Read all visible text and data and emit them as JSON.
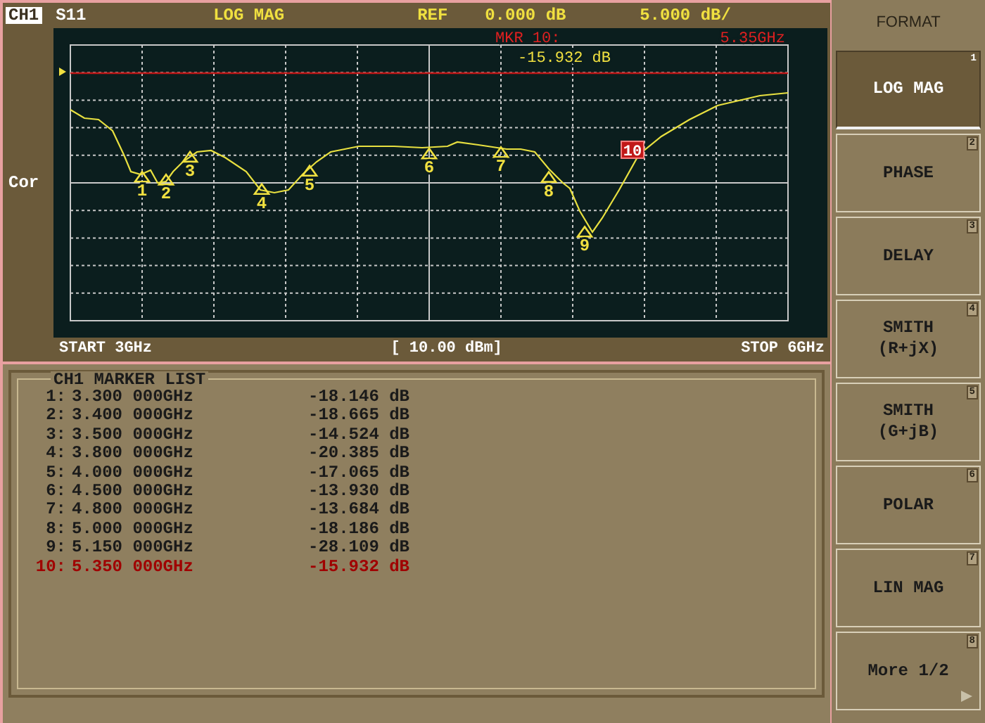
{
  "header": {
    "channel": "CH1",
    "parameter": "S11",
    "format": "LOG MAG",
    "ref_label": "REF",
    "ref_value": "0.000 dB",
    "scale": "5.000 dB/"
  },
  "plot": {
    "side_label": "Cor",
    "marker_readout": {
      "label": "MKR 10:",
      "frequency": "5.35GHz",
      "value": "-15.932 dB"
    },
    "markers": [
      {
        "label": "1",
        "active": false
      },
      {
        "label": "2",
        "active": false
      },
      {
        "label": "3",
        "active": false
      },
      {
        "label": "4",
        "active": false
      },
      {
        "label": "5",
        "active": false
      },
      {
        "label": "6",
        "active": false
      },
      {
        "label": "7",
        "active": false
      },
      {
        "label": "8",
        "active": false
      },
      {
        "label": "9",
        "active": false
      },
      {
        "label": "10",
        "active": true
      }
    ],
    "start": "START 3GHz",
    "power": "[ 10.00 dBm]",
    "stop": "STOP 6GHz"
  },
  "marker_list": {
    "title": "CH1 MARKER LIST",
    "rows": [
      {
        "index": "1:",
        "frequency": "3.300 000GHz",
        "value": "-18.146 dB",
        "active": false
      },
      {
        "index": "2:",
        "frequency": "3.400 000GHz",
        "value": "-18.665 dB",
        "active": false
      },
      {
        "index": "3:",
        "frequency": "3.500 000GHz",
        "value": "-14.524 dB",
        "active": false
      },
      {
        "index": "4:",
        "frequency": "3.800 000GHz",
        "value": "-20.385 dB",
        "active": false
      },
      {
        "index": "5:",
        "frequency": "4.000 000GHz",
        "value": "-17.065 dB",
        "active": false
      },
      {
        "index": "6:",
        "frequency": "4.500 000GHz",
        "value": "-13.930 dB",
        "active": false
      },
      {
        "index": "7:",
        "frequency": "4.800 000GHz",
        "value": "-13.684 dB",
        "active": false
      },
      {
        "index": "8:",
        "frequency": "5.000 000GHz",
        "value": "-18.186 dB",
        "active": false
      },
      {
        "index": "9:",
        "frequency": "5.150 000GHz",
        "value": "-28.109 dB",
        "active": false
      },
      {
        "index": "10:",
        "frequency": "5.350 000GHz",
        "value": "-15.932 dB",
        "active": true
      }
    ]
  },
  "softkeys": {
    "title": "FORMAT",
    "items": [
      {
        "kind": "format",
        "lines": [
          "LOG MAG"
        ],
        "number": "1",
        "selected": true
      },
      {
        "kind": "format",
        "lines": [
          "PHASE"
        ],
        "number": "2",
        "selected": false
      },
      {
        "kind": "format",
        "lines": [
          "DELAY"
        ],
        "number": "3",
        "selected": false
      },
      {
        "kind": "format",
        "lines": [
          "SMITH",
          "(R+jX)"
        ],
        "number": "4",
        "selected": false
      },
      {
        "kind": "format",
        "lines": [
          "SMITH",
          "(G+jB)"
        ],
        "number": "5",
        "selected": false
      },
      {
        "kind": "format",
        "lines": [
          "POLAR"
        ],
        "number": "6",
        "selected": false
      },
      {
        "kind": "format",
        "lines": [
          "LIN MAG"
        ],
        "number": "7",
        "selected": false
      },
      {
        "kind": "more",
        "lines": [
          "More 1/2"
        ],
        "number": "8",
        "selected": false
      }
    ]
  }
}
